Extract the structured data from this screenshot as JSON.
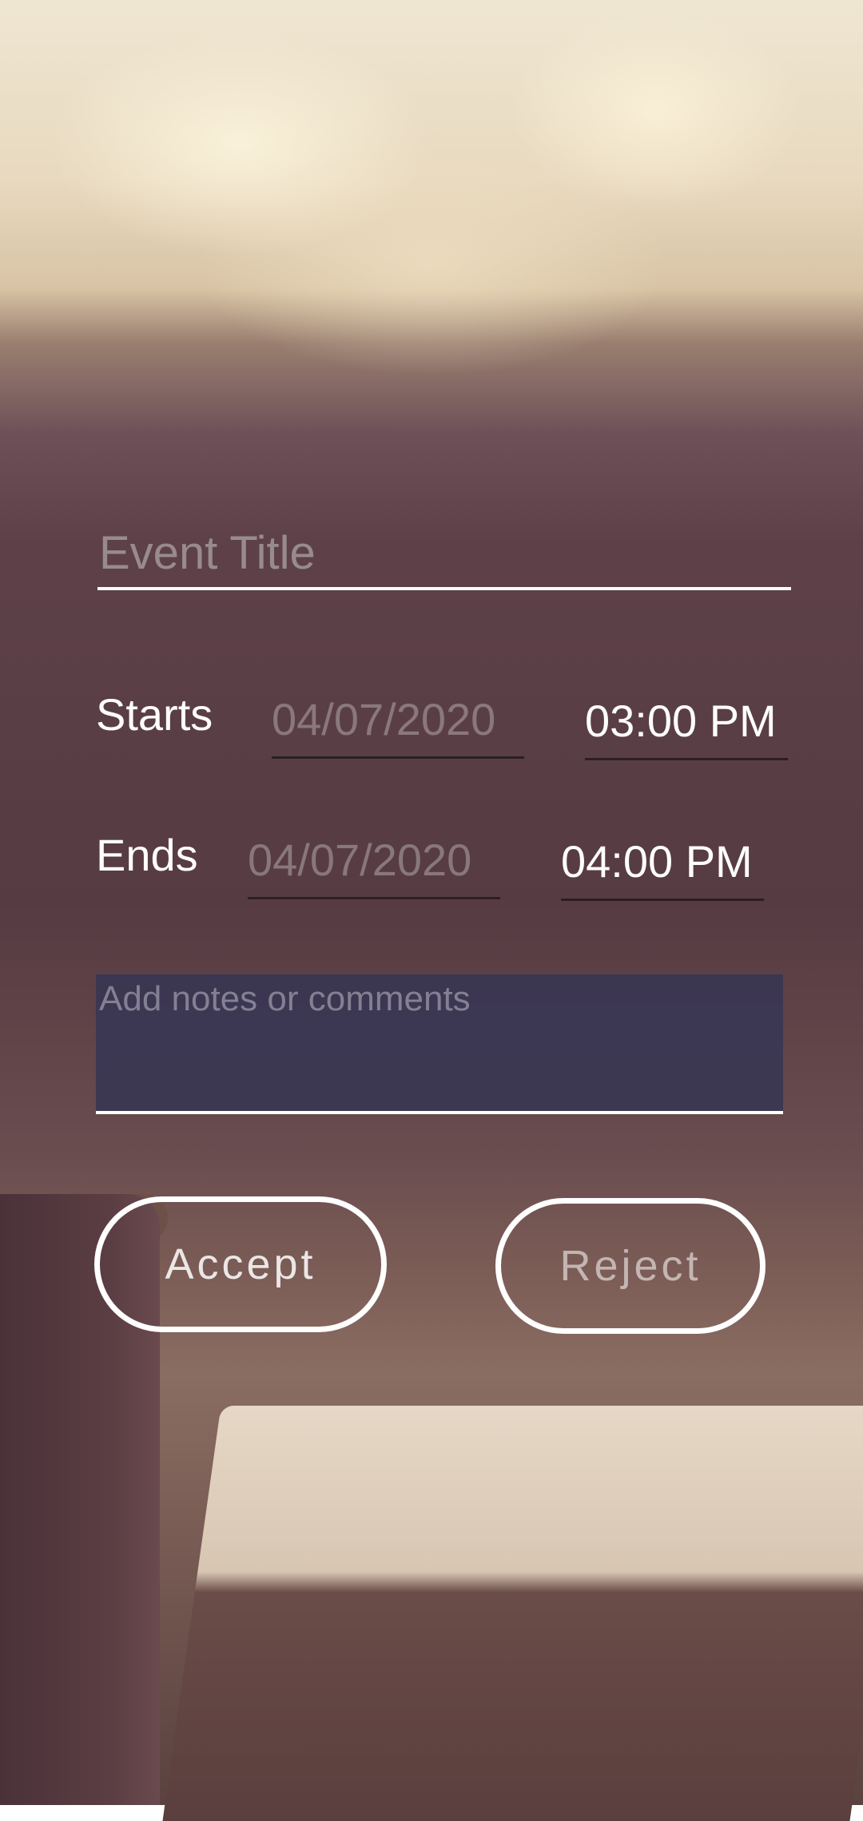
{
  "event_title": {
    "placeholder": "Event Title",
    "value": ""
  },
  "starts": {
    "label": "Starts",
    "date": "04/07/2020",
    "time": "03:00 PM"
  },
  "ends": {
    "label": "Ends",
    "date": "04/07/2020",
    "time": "04:00 PM"
  },
  "notes": {
    "placeholder": "Add notes or comments",
    "value": ""
  },
  "buttons": {
    "accept": "Accept",
    "reject": "Reject"
  }
}
